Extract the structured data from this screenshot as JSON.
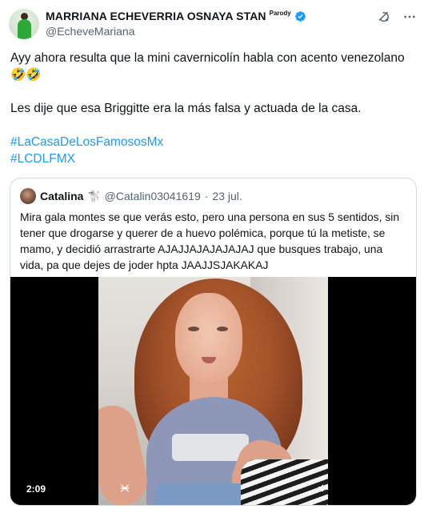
{
  "author": {
    "display_name": "MARRIANA ECHEVERRIA OSNAYA STAN",
    "parody_label": "Parody",
    "handle": "@EcheveMariana",
    "verified_color": "#1d9bf0"
  },
  "header_actions": {
    "grok_icon": "grok-icon",
    "more_icon": "more-icon"
  },
  "tweet": {
    "line1": "Ayy ahora resulta que la mini cavernicolín habla con acento venezolano",
    "line1_emoji": "🤣🤣",
    "line2": "Les dije que esa Briggitte era la más falsa y actuada de la casa.",
    "hashtag1": "#LaCasaDeLosFamososMx",
    "hashtag2": "#LCDLFMX"
  },
  "quote": {
    "name": "Catalina",
    "dog_emoji": "🐩",
    "handle": "@Catalin03041619",
    "separator": "·",
    "date": "23 jul.",
    "text": "Mira gala montes se que verás esto, pero una persona en sus 5 sentidos, sin tener que drogarse y querer de a huevo polémica, porque tú la metiste, se mamo, y decidió arrastrarte AJAJJAJAJAJAJAJ que busques trabajo, una vida, pa que dejes de joder hpta JAAJJSJAKAKAJ",
    "video_duration": "2:09"
  },
  "colors": {
    "link": "#1d9bf0",
    "secondary_text": "#536471",
    "border": "#cfd9de"
  }
}
